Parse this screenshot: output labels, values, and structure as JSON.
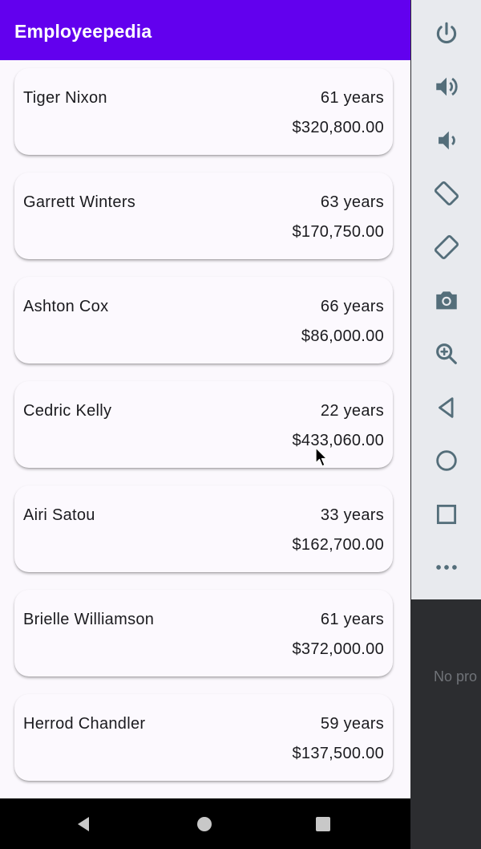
{
  "app": {
    "title": "Employeepedia"
  },
  "employees": [
    {
      "name": "Tiger Nixon",
      "age": "61 years",
      "salary": "$320,800.00"
    },
    {
      "name": "Garrett Winters",
      "age": "63 years",
      "salary": "$170,750.00"
    },
    {
      "name": "Ashton Cox",
      "age": "66 years",
      "salary": "$86,000.00"
    },
    {
      "name": "Cedric Kelly",
      "age": "22 years",
      "salary": "$433,060.00"
    },
    {
      "name": "Airi Satou",
      "age": "33 years",
      "salary": "$162,700.00"
    },
    {
      "name": "Brielle Williamson",
      "age": "61 years",
      "salary": "$372,000.00"
    },
    {
      "name": "Herrod Chandler",
      "age": "59 years",
      "salary": "$137,500.00"
    }
  ],
  "emulator": {
    "buttons": [
      "power-icon",
      "volume-up-icon",
      "volume-down-icon",
      "rotate-left-icon",
      "rotate-right-icon",
      "camera-icon",
      "zoom-icon",
      "back-icon",
      "home-icon",
      "overview-icon",
      "more-icon"
    ]
  },
  "ide": {
    "status_text": "No pro"
  },
  "colors": {
    "accent": "#6200ee",
    "card_bg": "#fcf9fe",
    "emulator_panel": "#e8eaee",
    "ide_bg": "#2c2d30"
  }
}
